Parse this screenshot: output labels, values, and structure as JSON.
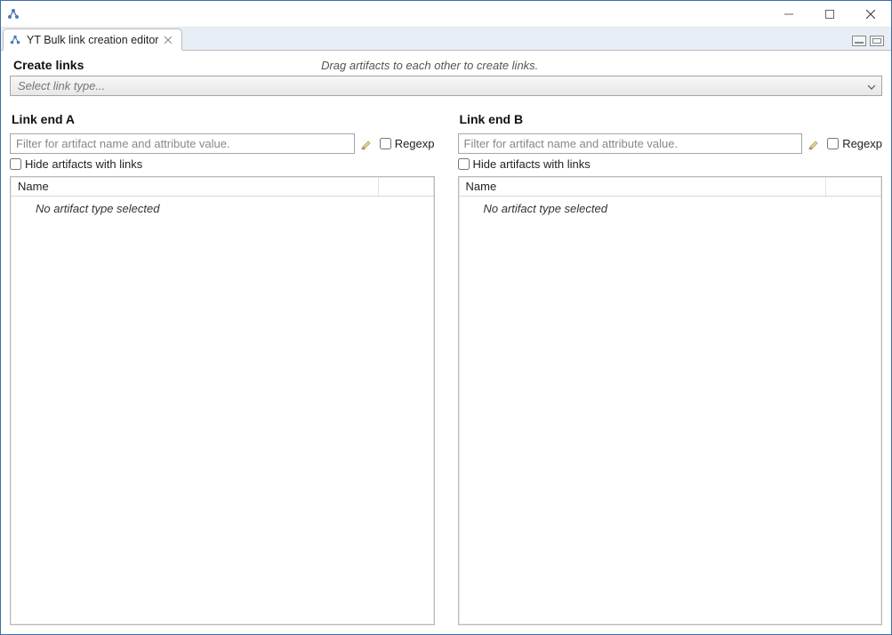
{
  "window": {
    "title": ""
  },
  "tab": {
    "title": "YT Bulk link creation editor"
  },
  "header": {
    "section_title": "Create links",
    "hint": "Drag artifacts to each other to create links.",
    "link_type_placeholder": "Select link type..."
  },
  "panels": {
    "a": {
      "title": "Link end A",
      "filter_placeholder": "Filter for artifact name and attribute value.",
      "regexp_label": "Regexp",
      "hide_links_label": "Hide artifacts with links",
      "column_name": "Name",
      "empty_message": "No artifact type selected"
    },
    "b": {
      "title": "Link end B",
      "filter_placeholder": "Filter for artifact name and attribute value.",
      "regexp_label": "Regexp",
      "hide_links_label": "Hide artifacts with links",
      "column_name": "Name",
      "empty_message": "No artifact type selected"
    }
  }
}
